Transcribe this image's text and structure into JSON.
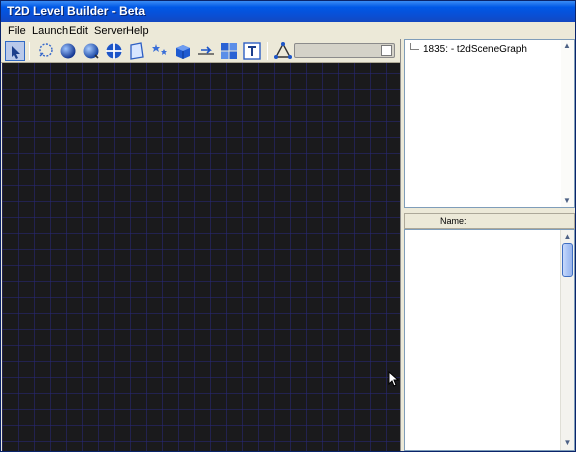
{
  "window": {
    "title": "T2D Level Builder - Beta"
  },
  "menubar": {
    "items": [
      {
        "label": "File"
      },
      {
        "label": "Launch"
      },
      {
        "label": "Edit"
      },
      {
        "label": "Server"
      },
      {
        "label": "Help"
      }
    ]
  },
  "toolbar": {
    "icons": [
      "select-arrow-icon",
      "lasso-select-icon",
      "blue-sphere-icon",
      "blue-globe-icon",
      "crosshair-globe-icon",
      "quad-panel-icon",
      "stars-particle-icon",
      "blue-cube-icon",
      "path-arrow-icon",
      "tile-grid-icon",
      "text-object-icon",
      "triangle-polygon-icon"
    ],
    "active_tool": "select-arrow-icon"
  },
  "scene": {
    "background_color": "#1a1a1c",
    "grid_color": "#282878"
  },
  "tree": {
    "nodes": [
      {
        "id": "1835:",
        "label": "- t2dSceneGraph"
      }
    ]
  },
  "properties": {
    "header_name": "Name:"
  },
  "colors": {
    "titlebar_accent": "#0058e6",
    "scroll_thumb": "#a9c4f5"
  }
}
